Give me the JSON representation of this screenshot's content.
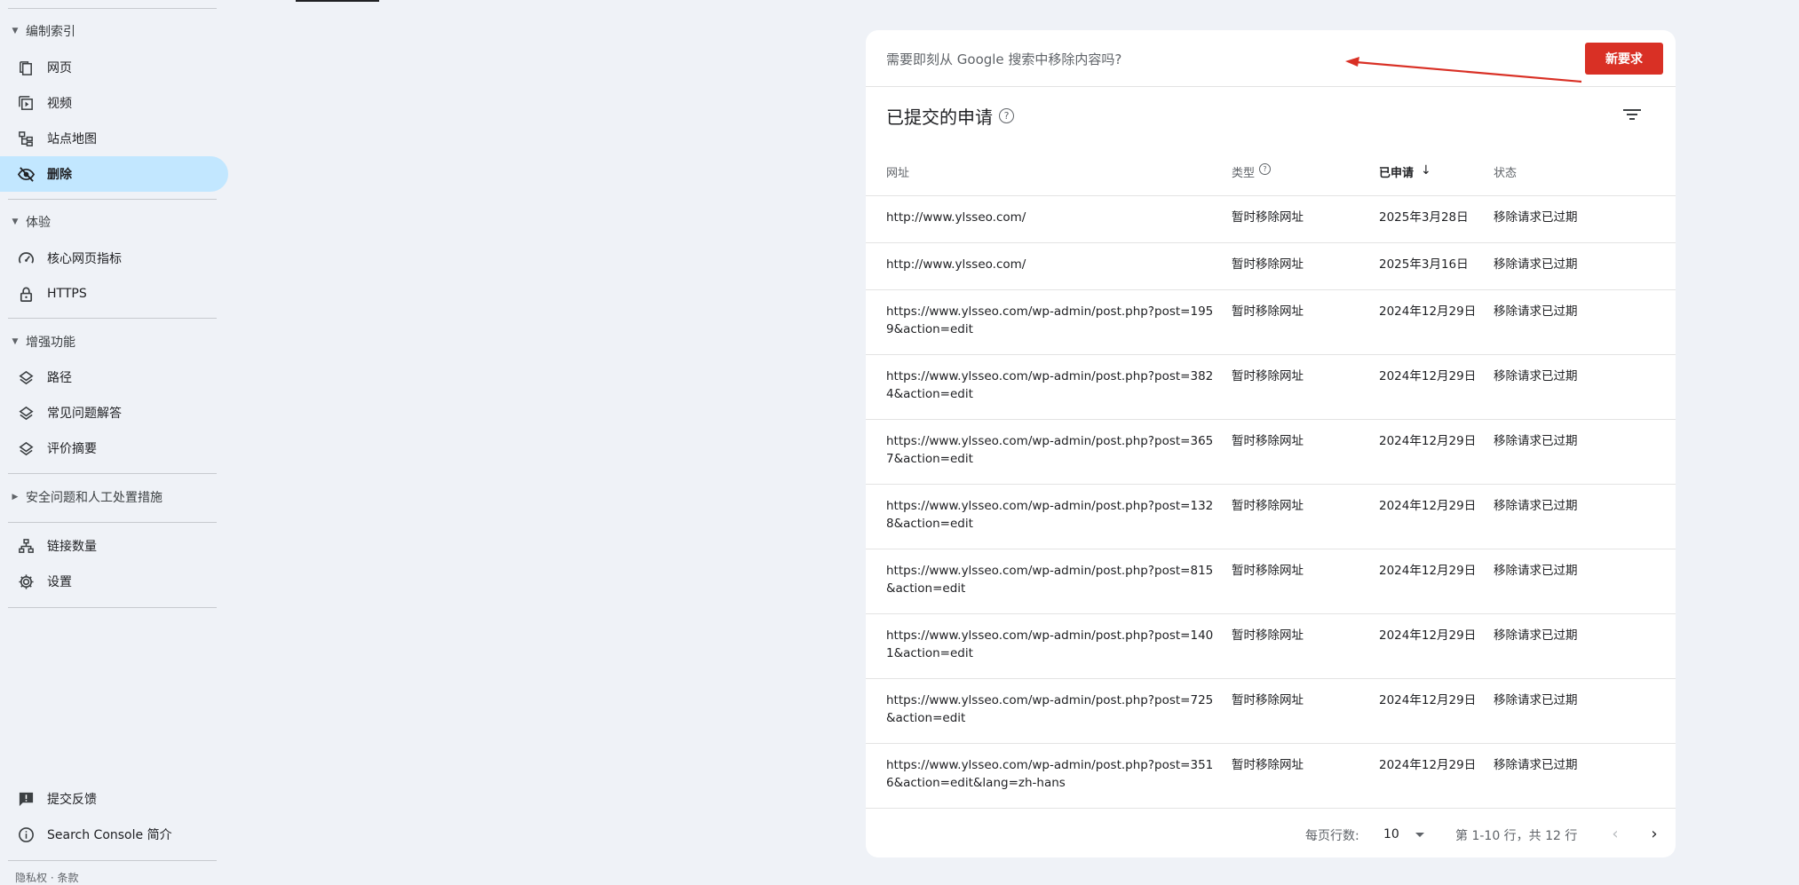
{
  "sidebar": {
    "sections": {
      "indexing": "编制索引",
      "experience": "体验",
      "enhancements": "增强功能",
      "security": "安全问题和人工处置措施"
    },
    "items": {
      "pages": "网页",
      "videos": "视频",
      "sitemaps": "站点地图",
      "removals": "删除",
      "core_web_vitals": "核心网页指标",
      "https": "HTTPS",
      "breadcrumbs": "路径",
      "faq": "常见问题解答",
      "review_snippets": "评价摘要",
      "links": "链接数量",
      "settings": "设置",
      "feedback": "提交反馈",
      "about": "Search Console 简介"
    },
    "footer_partial": "隐私权 · 条款"
  },
  "removal_bar": {
    "question": "需要即刻从 Google 搜索中移除内容吗?",
    "new_request": "新要求"
  },
  "table": {
    "title": "已提交的申请",
    "columns": {
      "url": "网址",
      "type": "类型",
      "requested": "已申请",
      "status": "状态"
    },
    "sort_arrow": "↓",
    "rows": [
      {
        "url": "http://www.ylsseo.com/",
        "type": "暂时移除网址",
        "date": "2025年3月28日",
        "status": "移除请求已过期"
      },
      {
        "url": "http://www.ylsseo.com/",
        "type": "暂时移除网址",
        "date": "2025年3月16日",
        "status": "移除请求已过期"
      },
      {
        "url": "https://www.ylsseo.com/wp-admin/post.php?post=1959&action=edit",
        "type": "暂时移除网址",
        "date": "2024年12月29日",
        "status": "移除请求已过期"
      },
      {
        "url": "https://www.ylsseo.com/wp-admin/post.php?post=3824&action=edit",
        "type": "暂时移除网址",
        "date": "2024年12月29日",
        "status": "移除请求已过期"
      },
      {
        "url": "https://www.ylsseo.com/wp-admin/post.php?post=3657&action=edit",
        "type": "暂时移除网址",
        "date": "2024年12月29日",
        "status": "移除请求已过期"
      },
      {
        "url": "https://www.ylsseo.com/wp-admin/post.php?post=1328&action=edit",
        "type": "暂时移除网址",
        "date": "2024年12月29日",
        "status": "移除请求已过期"
      },
      {
        "url": "https://www.ylsseo.com/wp-admin/post.php?post=815&action=edit",
        "type": "暂时移除网址",
        "date": "2024年12月29日",
        "status": "移除请求已过期"
      },
      {
        "url": "https://www.ylsseo.com/wp-admin/post.php?post=1401&action=edit",
        "type": "暂时移除网址",
        "date": "2024年12月29日",
        "status": "移除请求已过期"
      },
      {
        "url": "https://www.ylsseo.com/wp-admin/post.php?post=725&action=edit",
        "type": "暂时移除网址",
        "date": "2024年12月29日",
        "status": "移除请求已过期"
      },
      {
        "url": "https://www.ylsseo.com/wp-admin/post.php?post=3516&action=edit&lang=zh-hans",
        "type": "暂时移除网址",
        "date": "2024年12月29日",
        "status": "移除请求已过期"
      }
    ]
  },
  "pagination": {
    "rows_per_page_label": "每页行数:",
    "rows_per_page": "10",
    "range": "第 1-10 行，共 12 行",
    "prev": "‹",
    "next": "›"
  },
  "colors": {
    "accent_red": "#d93025",
    "active_nav": "#c2e7ff",
    "background": "#eff2f7"
  }
}
